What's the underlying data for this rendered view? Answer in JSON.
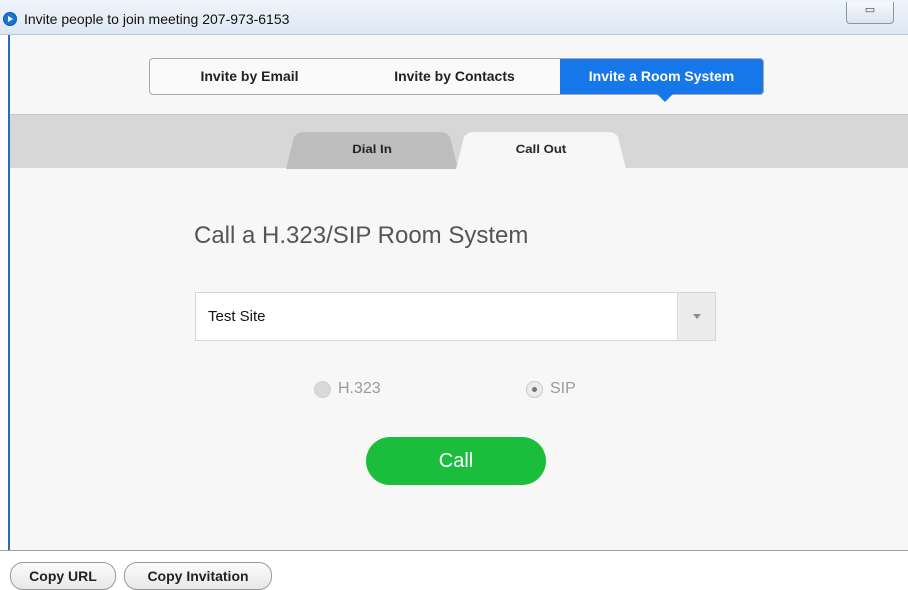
{
  "window": {
    "title": "Invite people to join meeting 207-973-6153",
    "restore_glyph": "▭"
  },
  "invite_tabs": [
    {
      "label": "Invite by Email",
      "selected": false
    },
    {
      "label": "Invite by Contacts",
      "selected": false
    },
    {
      "label": "Invite a Room System",
      "selected": true
    }
  ],
  "sub_tabs": [
    {
      "label": "Dial In",
      "selected": false
    },
    {
      "label": "Call Out",
      "selected": true
    }
  ],
  "main": {
    "heading": "Call a H.323/SIP Room System",
    "site_select": {
      "value": "Test Site"
    },
    "protocol_options": [
      {
        "label": "H.323",
        "checked": false,
        "enabled": false
      },
      {
        "label": "SIP",
        "checked": true,
        "enabled": false
      }
    ],
    "call_button": "Call"
  },
  "footer": {
    "copy_url": "Copy URL",
    "copy_invitation": "Copy Invitation"
  },
  "colors": {
    "accent_blue": "#1677ea",
    "call_green": "#1bbd3c",
    "tab_strip": "#d7d7d7",
    "panel_bg": "#f7f7f7"
  }
}
